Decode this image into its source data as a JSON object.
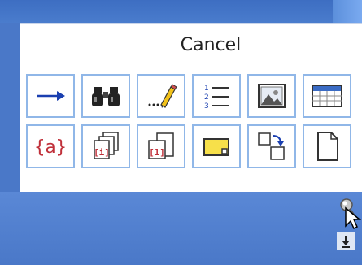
{
  "popup": {
    "title": "Cancel"
  },
  "tiles_row1": [
    {
      "name": "arrow-right-icon"
    },
    {
      "name": "binoculars-icon"
    },
    {
      "name": "signature-pencil-icon"
    },
    {
      "name": "numbered-list-icon"
    },
    {
      "name": "image-icon"
    },
    {
      "name": "table-icon"
    }
  ],
  "tiles_row2": [
    {
      "name": "field-code-icon",
      "text": "{a}"
    },
    {
      "name": "stacked-documents-icon",
      "text": "[i]"
    },
    {
      "name": "document-index-icon",
      "text": "[1]"
    },
    {
      "name": "yellow-frame-icon"
    },
    {
      "name": "swap-frames-icon"
    },
    {
      "name": "blank-page-icon"
    }
  ],
  "colors": {
    "background": "#4a78c8",
    "tile_border": "#90b7e8",
    "accent_red": "#c0303a",
    "accent_blue": "#1a3fb0"
  }
}
